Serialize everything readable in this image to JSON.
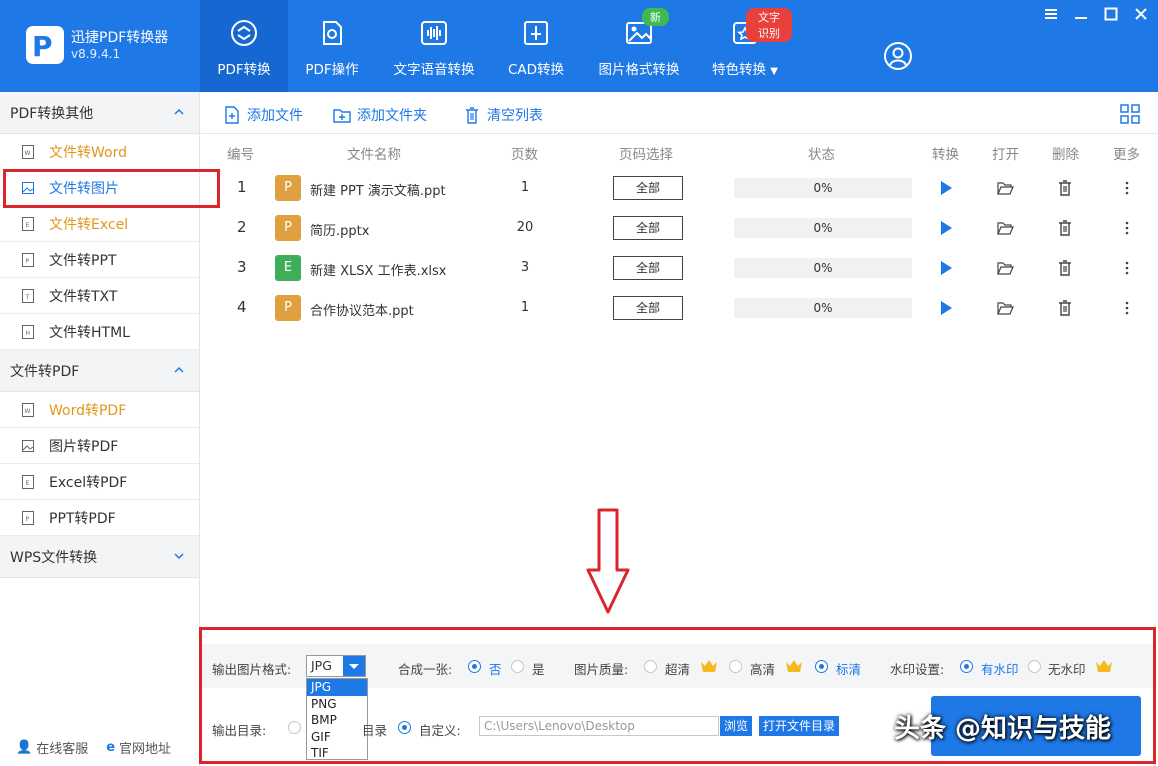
{
  "app": {
    "title": "迅捷PDF转换器",
    "version": "v8.9.4.1",
    "logo_letter": "P"
  },
  "nav": {
    "items": [
      {
        "label": "PDF转换",
        "icon": "pdf-convert-icon"
      },
      {
        "label": "PDF操作",
        "icon": "pdf-operate-icon"
      },
      {
        "label": "文字语音转换",
        "icon": "audio-wave-icon"
      },
      {
        "label": "CAD转换",
        "icon": "cad-icon"
      },
      {
        "label": "图片格式转换",
        "icon": "image-icon"
      },
      {
        "label": "特色转换",
        "icon": "star-swap-icon"
      }
    ],
    "badge_new": "新",
    "badge_ocr": "文字识别"
  },
  "sidebar": {
    "sections": [
      {
        "title": "PDF转换其他",
        "items": [
          "文件转Word",
          "文件转图片",
          "文件转Excel",
          "文件转PPT",
          "文件转TXT",
          "文件转HTML"
        ]
      },
      {
        "title": "文件转PDF",
        "items": [
          "Word转PDF",
          "图片转PDF",
          "Excel转PDF",
          "PPT转PDF"
        ]
      },
      {
        "title": "WPS文件转换",
        "items": []
      }
    ],
    "online_service": "在线客服",
    "website": "官网地址"
  },
  "toolbar": {
    "add_file": "添加文件",
    "add_folder": "添加文件夹",
    "clear_list": "清空列表"
  },
  "table": {
    "headers": {
      "num": "编号",
      "name": "文件名称",
      "pages": "页数",
      "page_select": "页码选择",
      "status": "状态",
      "convert": "转换",
      "open": "打开",
      "delete": "删除",
      "more": "更多"
    },
    "rows": [
      {
        "num": "1",
        "type": "P",
        "color": "#e0a040",
        "name": "新建 PPT 演示文稿.ppt",
        "pages": "1",
        "page_select": "全部",
        "progress": "0%"
      },
      {
        "num": "2",
        "type": "P",
        "color": "#e0a040",
        "name": "简历.pptx",
        "pages": "20",
        "page_select": "全部",
        "progress": "0%"
      },
      {
        "num": "3",
        "type": "E",
        "color": "#3fae5a",
        "name": "新建 XLSX 工作表.xlsx",
        "pages": "3",
        "page_select": "全部",
        "progress": "0%"
      },
      {
        "num": "4",
        "type": "P",
        "color": "#e0a040",
        "name": "合作协议范本.ppt",
        "pages": "1",
        "page_select": "全部",
        "progress": "0%"
      }
    ]
  },
  "settings": {
    "format_label": "输出图片格式:",
    "format_value": "JPG",
    "format_options": [
      "JPG",
      "PNG",
      "BMP",
      "GIF",
      "TIF"
    ],
    "merge_label": "合成一张:",
    "merge_no": "否",
    "merge_yes": "是",
    "quality_label": "图片质量:",
    "quality_options": [
      "超清",
      "高清",
      "标清"
    ],
    "watermark_label": "水印设置:",
    "watermark_on": "有水印",
    "watermark_off": "无水印",
    "output_dir_label": "输出目录:",
    "output_dir_partial": "目录",
    "custom_label": "自定义:",
    "path": "C:\\Users\\Lenovo\\Desktop",
    "browse": "浏览",
    "open_dir": "打开文件目录"
  },
  "overlay_text": "头条 @知识与技能",
  "colors": {
    "primary": "#1e78e6",
    "highlight": "#d9262c",
    "orange": "#e3961c"
  }
}
